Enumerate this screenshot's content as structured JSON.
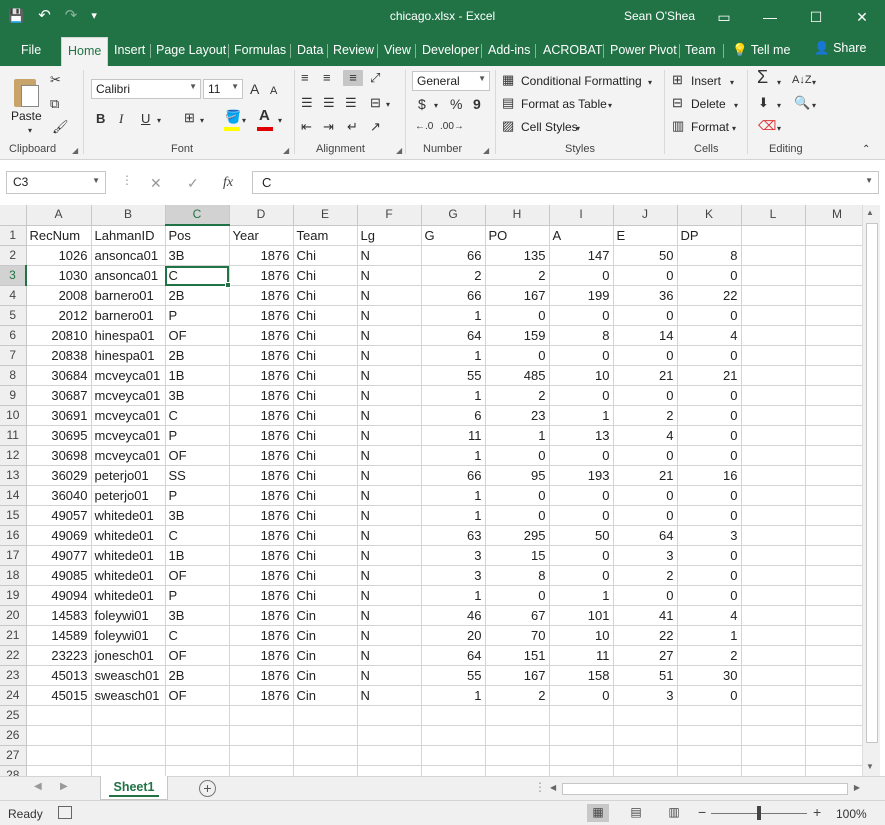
{
  "colors": {
    "accent": "#217346",
    "ribbon_bg": "#f3f3f3",
    "header_bg": "#efefef",
    "selected_header": "#d2d2d2"
  },
  "titlebar": {
    "doc_title": "chicago.xlsx - Excel",
    "user": "Sean O'Shea",
    "icons": {
      "save": "💾",
      "undo": "↶",
      "redo": "↷",
      "customize": "▾",
      "ribbon_display": "▭",
      "minimize": "—",
      "maximize": "☐",
      "close": "✕"
    }
  },
  "tabs": [
    {
      "label": "File"
    },
    {
      "label": "Home"
    },
    {
      "label": "Insert"
    },
    {
      "label": "Page Layout"
    },
    {
      "label": "Formulas"
    },
    {
      "label": "Data"
    },
    {
      "label": "Review"
    },
    {
      "label": "View"
    },
    {
      "label": "Developer"
    },
    {
      "label": "Add-ins"
    },
    {
      "label": "ACROBAT"
    },
    {
      "label": "Power Pivot"
    },
    {
      "label": "Team"
    }
  ],
  "tell_me": "Tell me",
  "share": "Share",
  "ribbon": {
    "clipboard": {
      "label": "Clipboard",
      "paste": "Paste"
    },
    "font": {
      "label": "Font",
      "name": "Calibri",
      "size": "11",
      "bold": "B",
      "italic": "I",
      "underline": "U",
      "grow": "A",
      "shrink": "A"
    },
    "alignment": {
      "label": "Alignment"
    },
    "number": {
      "label": "Number",
      "format": "General",
      "currency": "$",
      "percent": "%",
      "comma": "9"
    },
    "styles": {
      "label": "Styles",
      "conditional": "Conditional Formatting",
      "format_table": "Format as Table",
      "cell_styles": "Cell Styles"
    },
    "cells": {
      "label": "Cells",
      "insert": "Insert",
      "delete": "Delete",
      "format": "Format"
    },
    "editing": {
      "label": "Editing",
      "sum": "Σ"
    }
  },
  "formula_bar": {
    "name_box": "C3",
    "cancel": "✕",
    "enter": "✓",
    "fx": "fx",
    "content": "C"
  },
  "sheet": {
    "columns": [
      "A",
      "B",
      "C",
      "D",
      "E",
      "F",
      "G",
      "H",
      "I",
      "J",
      "K",
      "L",
      "M"
    ],
    "header_row": [
      "RecNum",
      "LahmanID",
      "Pos",
      "Year",
      "Team",
      "Lg",
      "G",
      "PO",
      "A",
      "E",
      "DP"
    ],
    "rows": [
      [
        "1026",
        "ansonca01",
        "3B",
        "1876",
        "Chi",
        "N",
        "66",
        "135",
        "147",
        "50",
        "8"
      ],
      [
        "1030",
        "ansonca01",
        "C",
        "1876",
        "Chi",
        "N",
        "2",
        "2",
        "0",
        "0",
        "0"
      ],
      [
        "2008",
        "barnero01",
        "2B",
        "1876",
        "Chi",
        "N",
        "66",
        "167",
        "199",
        "36",
        "22"
      ],
      [
        "2012",
        "barnero01",
        "P",
        "1876",
        "Chi",
        "N",
        "1",
        "0",
        "0",
        "0",
        "0"
      ],
      [
        "20810",
        "hinespa01",
        "OF",
        "1876",
        "Chi",
        "N",
        "64",
        "159",
        "8",
        "14",
        "4"
      ],
      [
        "20838",
        "hinespa01",
        "2B",
        "1876",
        "Chi",
        "N",
        "1",
        "0",
        "0",
        "0",
        "0"
      ],
      [
        "30684",
        "mcveyca01",
        "1B",
        "1876",
        "Chi",
        "N",
        "55",
        "485",
        "10",
        "21",
        "21"
      ],
      [
        "30687",
        "mcveyca01",
        "3B",
        "1876",
        "Chi",
        "N",
        "1",
        "2",
        "0",
        "0",
        "0"
      ],
      [
        "30691",
        "mcveyca01",
        "C",
        "1876",
        "Chi",
        "N",
        "6",
        "23",
        "1",
        "2",
        "0"
      ],
      [
        "30695",
        "mcveyca01",
        "P",
        "1876",
        "Chi",
        "N",
        "11",
        "1",
        "13",
        "4",
        "0"
      ],
      [
        "30698",
        "mcveyca01",
        "OF",
        "1876",
        "Chi",
        "N",
        "1",
        "0",
        "0",
        "0",
        "0"
      ],
      [
        "36029",
        "peterjo01",
        "SS",
        "1876",
        "Chi",
        "N",
        "66",
        "95",
        "193",
        "21",
        "16"
      ],
      [
        "36040",
        "peterjo01",
        "P",
        "1876",
        "Chi",
        "N",
        "1",
        "0",
        "0",
        "0",
        "0"
      ],
      [
        "49057",
        "whitede01",
        "3B",
        "1876",
        "Chi",
        "N",
        "1",
        "0",
        "0",
        "0",
        "0"
      ],
      [
        "49069",
        "whitede01",
        "C",
        "1876",
        "Chi",
        "N",
        "63",
        "295",
        "50",
        "64",
        "3"
      ],
      [
        "49077",
        "whitede01",
        "1B",
        "1876",
        "Chi",
        "N",
        "3",
        "15",
        "0",
        "3",
        "0"
      ],
      [
        "49085",
        "whitede01",
        "OF",
        "1876",
        "Chi",
        "N",
        "3",
        "8",
        "0",
        "2",
        "0"
      ],
      [
        "49094",
        "whitede01",
        "P",
        "1876",
        "Chi",
        "N",
        "1",
        "0",
        "1",
        "0",
        "0"
      ],
      [
        "14583",
        "foleywi01",
        "3B",
        "1876",
        "Cin",
        "N",
        "46",
        "67",
        "101",
        "41",
        "4"
      ],
      [
        "14589",
        "foleywi01",
        "C",
        "1876",
        "Cin",
        "N",
        "20",
        "70",
        "10",
        "22",
        "1"
      ],
      [
        "23223",
        "jonesch01",
        "OF",
        "1876",
        "Cin",
        "N",
        "64",
        "151",
        "11",
        "27",
        "2"
      ],
      [
        "45013",
        "sweasch01",
        "2B",
        "1876",
        "Cin",
        "N",
        "55",
        "167",
        "158",
        "51",
        "30"
      ],
      [
        "45015",
        "sweasch01",
        "OF",
        "1876",
        "Cin",
        "N",
        "1",
        "2",
        "0",
        "3",
        "0"
      ]
    ],
    "row_numbers": [
      "1",
      "2",
      "3",
      "4",
      "5",
      "6",
      "7",
      "8",
      "9",
      "10",
      "11",
      "12",
      "13",
      "14",
      "15",
      "16",
      "17",
      "18",
      "19",
      "20",
      "21",
      "22",
      "23",
      "24",
      "25",
      "26",
      "27",
      "28"
    ],
    "selected_cell": "C3",
    "tab_name": "Sheet1"
  },
  "status": {
    "ready": "Ready",
    "zoom": "100%"
  }
}
